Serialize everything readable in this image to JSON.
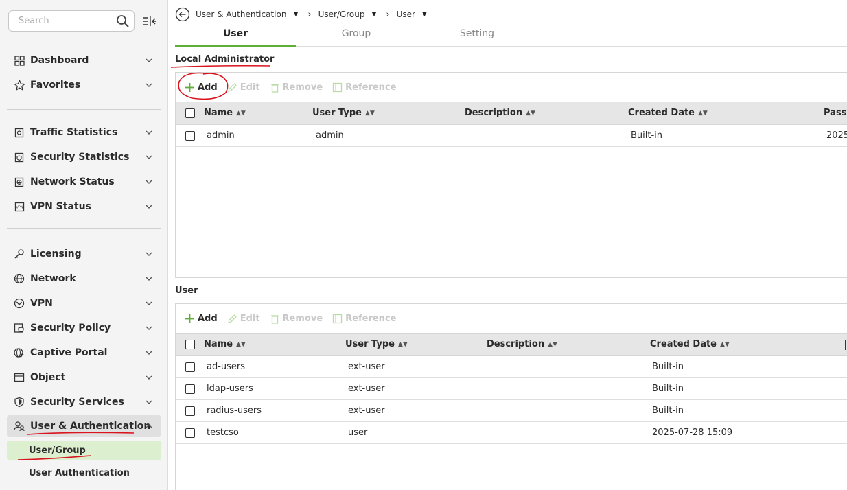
{
  "sidebar": {
    "search_placeholder": "Search",
    "groups": [
      [
        {
          "label": "Dashboard",
          "icon": "dashboard-icon"
        },
        {
          "label": "Favorites",
          "icon": "star-icon"
        }
      ],
      [
        {
          "label": "Traffic Statistics",
          "icon": "traffic-statistics-icon"
        },
        {
          "label": "Security Statistics",
          "icon": "security-statistics-icon"
        },
        {
          "label": "Network Status",
          "icon": "network-status-icon"
        },
        {
          "label": "VPN Status",
          "icon": "vpn-status-icon"
        }
      ],
      [
        {
          "label": "Licensing",
          "icon": "key-icon"
        },
        {
          "label": "Network",
          "icon": "globe-icon"
        },
        {
          "label": "VPN",
          "icon": "vpn-shield-icon"
        },
        {
          "label": "Security Policy",
          "icon": "security-policy-icon"
        },
        {
          "label": "Captive Portal",
          "icon": "captive-portal-icon"
        },
        {
          "label": "Object",
          "icon": "object-icon"
        },
        {
          "label": "Security Services",
          "icon": "shield-icon"
        },
        {
          "label": "User & Authentication",
          "icon": "users-icon",
          "expanded": true
        }
      ]
    ],
    "sub_items": [
      {
        "label": "User/Group",
        "active": true
      },
      {
        "label": "User Authentication",
        "active": false
      }
    ]
  },
  "breadcrumb": [
    "User & Authentication",
    "User/Group",
    "User"
  ],
  "tabs": [
    {
      "label": "User",
      "active": true
    },
    {
      "label": "Group",
      "active": false
    },
    {
      "label": "Setting",
      "active": false
    }
  ],
  "toolbar": {
    "add": "Add",
    "edit": "Edit",
    "remove": "Remove",
    "reference": "Reference"
  },
  "local_admin": {
    "title": "Local Administrator",
    "columns": [
      "Name",
      "User Type",
      "Description",
      "Created Date",
      "Passw"
    ],
    "rows": [
      {
        "name": "admin",
        "user_type": "admin",
        "description": "",
        "created": "Built-in",
        "password": "2025"
      }
    ]
  },
  "user": {
    "title": "User",
    "columns": [
      "Name",
      "User Type",
      "Description",
      "Created Date"
    ],
    "rows": [
      {
        "name": "ad-users",
        "user_type": "ext-user",
        "description": "",
        "created": "Built-in"
      },
      {
        "name": "ldap-users",
        "user_type": "ext-user",
        "description": "",
        "created": "Built-in"
      },
      {
        "name": "radius-users",
        "user_type": "ext-user",
        "description": "",
        "created": "Built-in"
      },
      {
        "name": "testcso",
        "user_type": "user",
        "description": "",
        "created": "2025-07-28 15:09"
      }
    ]
  },
  "colors": {
    "accent_green": "#5fae3a",
    "active_sub_bg": "#dcefcf",
    "annotation_red": "#d9141e"
  }
}
